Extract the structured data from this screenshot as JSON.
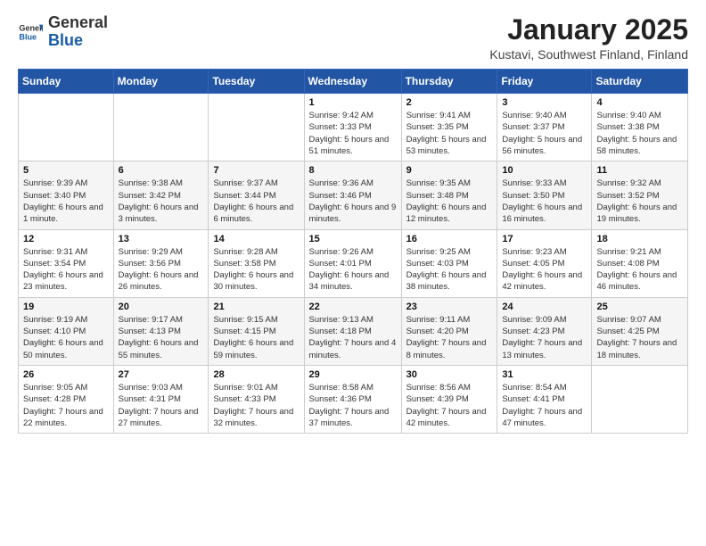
{
  "header": {
    "logo_general": "General",
    "logo_blue": "Blue",
    "month": "January 2025",
    "location": "Kustavi, Southwest Finland, Finland"
  },
  "weekdays": [
    "Sunday",
    "Monday",
    "Tuesday",
    "Wednesday",
    "Thursday",
    "Friday",
    "Saturday"
  ],
  "weeks": [
    [
      {
        "day": "",
        "info": ""
      },
      {
        "day": "",
        "info": ""
      },
      {
        "day": "",
        "info": ""
      },
      {
        "day": "1",
        "info": "Sunrise: 9:42 AM\nSunset: 3:33 PM\nDaylight: 5 hours and 51 minutes."
      },
      {
        "day": "2",
        "info": "Sunrise: 9:41 AM\nSunset: 3:35 PM\nDaylight: 5 hours and 53 minutes."
      },
      {
        "day": "3",
        "info": "Sunrise: 9:40 AM\nSunset: 3:37 PM\nDaylight: 5 hours and 56 minutes."
      },
      {
        "day": "4",
        "info": "Sunrise: 9:40 AM\nSunset: 3:38 PM\nDaylight: 5 hours and 58 minutes."
      }
    ],
    [
      {
        "day": "5",
        "info": "Sunrise: 9:39 AM\nSunset: 3:40 PM\nDaylight: 6 hours and 1 minute."
      },
      {
        "day": "6",
        "info": "Sunrise: 9:38 AM\nSunset: 3:42 PM\nDaylight: 6 hours and 3 minutes."
      },
      {
        "day": "7",
        "info": "Sunrise: 9:37 AM\nSunset: 3:44 PM\nDaylight: 6 hours and 6 minutes."
      },
      {
        "day": "8",
        "info": "Sunrise: 9:36 AM\nSunset: 3:46 PM\nDaylight: 6 hours and 9 minutes."
      },
      {
        "day": "9",
        "info": "Sunrise: 9:35 AM\nSunset: 3:48 PM\nDaylight: 6 hours and 12 minutes."
      },
      {
        "day": "10",
        "info": "Sunrise: 9:33 AM\nSunset: 3:50 PM\nDaylight: 6 hours and 16 minutes."
      },
      {
        "day": "11",
        "info": "Sunrise: 9:32 AM\nSunset: 3:52 PM\nDaylight: 6 hours and 19 minutes."
      }
    ],
    [
      {
        "day": "12",
        "info": "Sunrise: 9:31 AM\nSunset: 3:54 PM\nDaylight: 6 hours and 23 minutes."
      },
      {
        "day": "13",
        "info": "Sunrise: 9:29 AM\nSunset: 3:56 PM\nDaylight: 6 hours and 26 minutes."
      },
      {
        "day": "14",
        "info": "Sunrise: 9:28 AM\nSunset: 3:58 PM\nDaylight: 6 hours and 30 minutes."
      },
      {
        "day": "15",
        "info": "Sunrise: 9:26 AM\nSunset: 4:01 PM\nDaylight: 6 hours and 34 minutes."
      },
      {
        "day": "16",
        "info": "Sunrise: 9:25 AM\nSunset: 4:03 PM\nDaylight: 6 hours and 38 minutes."
      },
      {
        "day": "17",
        "info": "Sunrise: 9:23 AM\nSunset: 4:05 PM\nDaylight: 6 hours and 42 minutes."
      },
      {
        "day": "18",
        "info": "Sunrise: 9:21 AM\nSunset: 4:08 PM\nDaylight: 6 hours and 46 minutes."
      }
    ],
    [
      {
        "day": "19",
        "info": "Sunrise: 9:19 AM\nSunset: 4:10 PM\nDaylight: 6 hours and 50 minutes."
      },
      {
        "day": "20",
        "info": "Sunrise: 9:17 AM\nSunset: 4:13 PM\nDaylight: 6 hours and 55 minutes."
      },
      {
        "day": "21",
        "info": "Sunrise: 9:15 AM\nSunset: 4:15 PM\nDaylight: 6 hours and 59 minutes."
      },
      {
        "day": "22",
        "info": "Sunrise: 9:13 AM\nSunset: 4:18 PM\nDaylight: 7 hours and 4 minutes."
      },
      {
        "day": "23",
        "info": "Sunrise: 9:11 AM\nSunset: 4:20 PM\nDaylight: 7 hours and 8 minutes."
      },
      {
        "day": "24",
        "info": "Sunrise: 9:09 AM\nSunset: 4:23 PM\nDaylight: 7 hours and 13 minutes."
      },
      {
        "day": "25",
        "info": "Sunrise: 9:07 AM\nSunset: 4:25 PM\nDaylight: 7 hours and 18 minutes."
      }
    ],
    [
      {
        "day": "26",
        "info": "Sunrise: 9:05 AM\nSunset: 4:28 PM\nDaylight: 7 hours and 22 minutes."
      },
      {
        "day": "27",
        "info": "Sunrise: 9:03 AM\nSunset: 4:31 PM\nDaylight: 7 hours and 27 minutes."
      },
      {
        "day": "28",
        "info": "Sunrise: 9:01 AM\nSunset: 4:33 PM\nDaylight: 7 hours and 32 minutes."
      },
      {
        "day": "29",
        "info": "Sunrise: 8:58 AM\nSunset: 4:36 PM\nDaylight: 7 hours and 37 minutes."
      },
      {
        "day": "30",
        "info": "Sunrise: 8:56 AM\nSunset: 4:39 PM\nDaylight: 7 hours and 42 minutes."
      },
      {
        "day": "31",
        "info": "Sunrise: 8:54 AM\nSunset: 4:41 PM\nDaylight: 7 hours and 47 minutes."
      },
      {
        "day": "",
        "info": ""
      }
    ]
  ]
}
